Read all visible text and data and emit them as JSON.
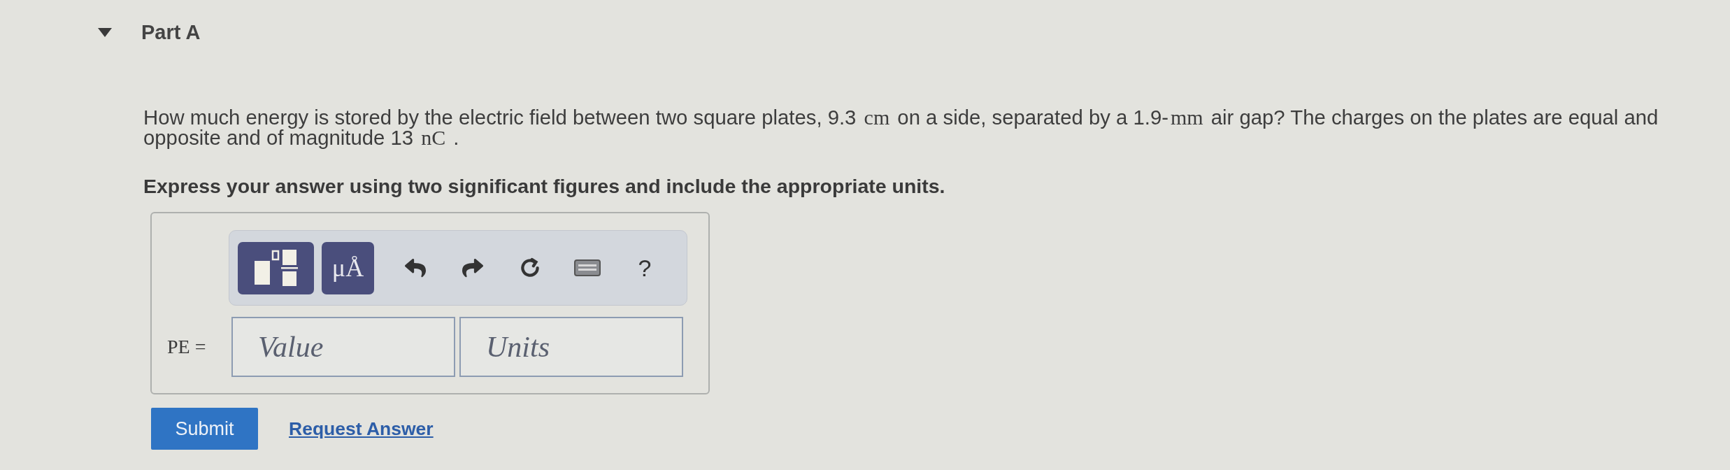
{
  "part": {
    "title": "Part A",
    "expanded": true
  },
  "question": {
    "segments": [
      {
        "kind": "text",
        "text": "How much energy is stored by the electric field between two square plates, 9.3 "
      },
      {
        "kind": "math",
        "text": "cm"
      },
      {
        "kind": "text",
        "text": " on a side, separated by a 1.9-"
      },
      {
        "kind": "math",
        "text": "mm"
      },
      {
        "kind": "text",
        "text": " air gap? The charges on the plates are equal and opposite and of magnitude 13 "
      },
      {
        "kind": "math",
        "text": "nC"
      },
      {
        "kind": "text",
        "text": " ."
      }
    ]
  },
  "instruction": "Express your answer using two significant figures and include the appropriate units.",
  "answer": {
    "toolbar": [
      {
        "kind": "template"
      },
      {
        "kind": "units",
        "label": "μÅ"
      },
      {
        "kind": "undo"
      },
      {
        "kind": "redo"
      },
      {
        "kind": "reset"
      },
      {
        "kind": "keyboard"
      },
      {
        "kind": "help",
        "label": "?"
      }
    ],
    "label": "PE =",
    "fields": [
      {
        "placeholder": "Value"
      },
      {
        "placeholder": "Units"
      }
    ]
  },
  "actions": {
    "submit": "Submit",
    "request": "Request Answer"
  }
}
